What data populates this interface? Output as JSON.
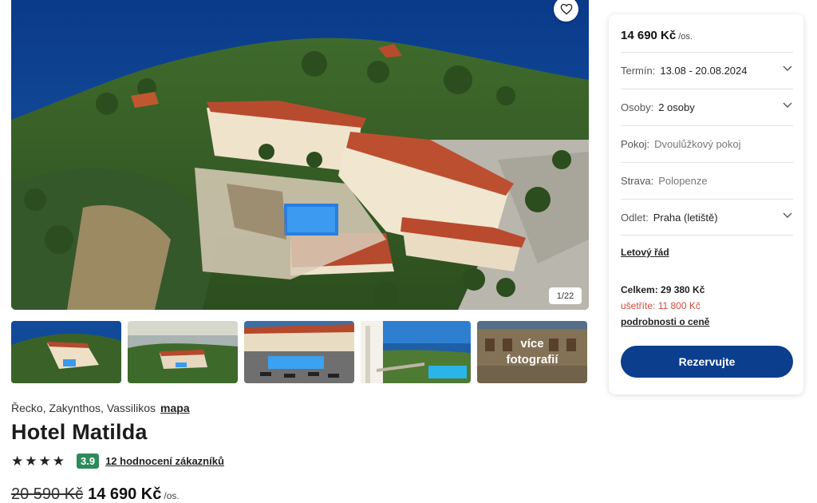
{
  "gallery": {
    "counter": "1/22",
    "favorite_icon": "heart-icon",
    "thumbs": [
      {
        "name": "thumb-aerial"
      },
      {
        "name": "thumb-panorama"
      },
      {
        "name": "thumb-pool-terrace"
      },
      {
        "name": "thumb-sea-view"
      },
      {
        "name": "thumb-building",
        "more_label": "více fotografií"
      }
    ]
  },
  "hotel": {
    "location": "Řecko, Zakynthos, Vassilikos",
    "map_link": "mapa",
    "name": "Hotel Matilda",
    "stars": 4,
    "score": "3.9",
    "reviews": "12 hodnocení zákazníků",
    "old_price": "20 590 Kč",
    "new_price": "14 690 Kč",
    "per_person": "/os."
  },
  "booking": {
    "price": "14 690 Kč",
    "per_person": "/os.",
    "rows": [
      {
        "label": "Termín:",
        "value": "13.08 - 20.08.2024",
        "dropdown": true
      },
      {
        "label": "Osoby:",
        "value": "2 osoby",
        "dropdown": true
      },
      {
        "label": "Pokoj:",
        "value": "Dvoulůžkový pokoj",
        "dropdown": false
      },
      {
        "label": "Strava:",
        "value": "Polopenze",
        "dropdown": false
      },
      {
        "label": "Odlet:",
        "value": "Praha (letiště)",
        "dropdown": true
      }
    ],
    "flight_link": "Letový řád",
    "total": "Celkem: 29 380 Kč",
    "savings": "ušetříte: 11 800 Kč",
    "details_link": "podrobnosti o ceně",
    "reserve_button": "Rezervujte"
  },
  "colors": {
    "primary": "#0b3e8c",
    "score_badge": "#2f8a5b",
    "savings": "#d24a3c"
  }
}
